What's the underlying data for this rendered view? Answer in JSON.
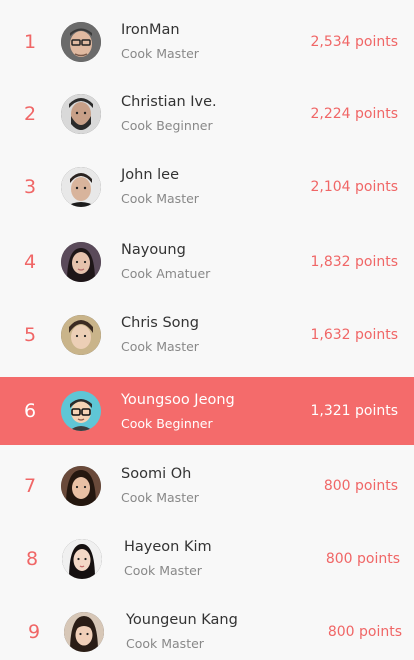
{
  "leaderboard": {
    "entries": [
      {
        "rank": "1",
        "name": "IronMan",
        "level": "Cook Master",
        "points": "2,534 points",
        "avatar": "man-glasses-avatar"
      },
      {
        "rank": "2",
        "name": "Christian Ive.",
        "level": "Cook Beginner",
        "points": "2,224 points",
        "avatar": "bearded-man-avatar"
      },
      {
        "rank": "3",
        "name": "John lee",
        "level": "Cook Master",
        "points": "2,104 points",
        "avatar": "dark-haired-man-avatar"
      },
      {
        "rank": "4",
        "name": "Nayoung",
        "level": "Cook Amatuer",
        "points": "1,832 points",
        "avatar": "woman-long-hair-avatar"
      },
      {
        "rank": "5",
        "name": "Chris Song",
        "level": "Cook Master",
        "points": "1,632 points",
        "avatar": "young-man-avatar"
      },
      {
        "rank": "6",
        "name": "Youngsoo Jeong",
        "level": "Cook Beginner",
        "points": "1,321 points",
        "avatar": "cartoon-man-glasses-avatar"
      },
      {
        "rank": "7",
        "name": "Soomi Oh",
        "level": "Cook Master",
        "points": "800 points",
        "avatar": "woman-dark-hair-avatar"
      },
      {
        "rank": "8",
        "name": "Hayeon Kim",
        "level": "Cook Master",
        "points": "800 points",
        "avatar": "woman-portrait-avatar"
      },
      {
        "rank": "9",
        "name": "Youngeun Kang",
        "level": "Cook Master",
        "points": "800 points",
        "avatar": "woman-bangs-avatar"
      }
    ],
    "highlighted_rank": "6"
  },
  "colors": {
    "accent": "#f06666",
    "highlight_bg": "#f46b6b",
    "background": "#f8f8f8",
    "name_text": "#333333",
    "level_text": "#888888"
  }
}
